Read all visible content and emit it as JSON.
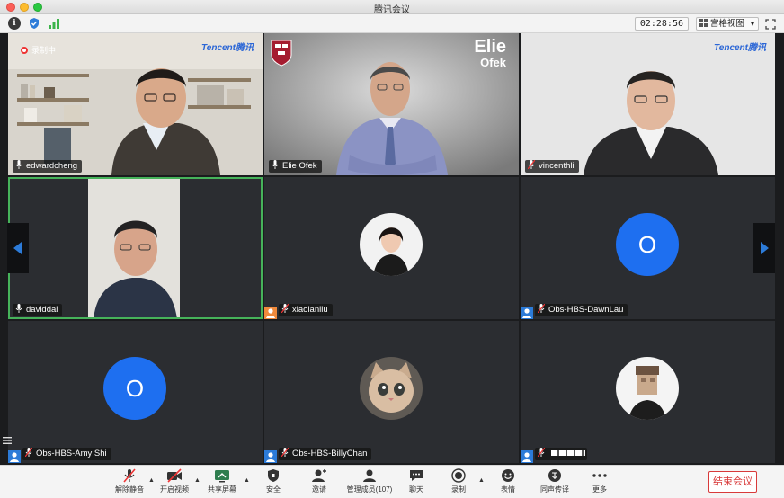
{
  "window": {
    "title": "腾讯会议"
  },
  "topbar": {
    "timer": "02:28:56",
    "view_label": "宫格视图"
  },
  "recording_label": "录制中",
  "brand_logo": "Tencent腾讯",
  "banner_name": {
    "first": "Elie",
    "last": "Ofek"
  },
  "participants": [
    {
      "name": "edwardcheng",
      "type": "video"
    },
    {
      "name": "Elie Ofek",
      "type": "video"
    },
    {
      "name": "vincenthli",
      "type": "video"
    },
    {
      "name": "daviddai",
      "type": "video"
    },
    {
      "name": "xiaolanliu",
      "type": "photo"
    },
    {
      "name": "Obs-HBS-DawnLau",
      "type": "letter",
      "initial": "O"
    },
    {
      "name": "Obs-HBS-Amy Shi",
      "type": "letter",
      "initial": "O"
    },
    {
      "name": "Obs-HBS-BillyChan",
      "type": "photo"
    },
    {
      "name": "",
      "type": "photo"
    }
  ],
  "bottombar": {
    "items": [
      {
        "label": "解除静音",
        "icon": "mic-muted-icon"
      },
      {
        "label": "开启视频",
        "icon": "camera-off-icon"
      },
      {
        "label": "共享屏幕",
        "icon": "screen-share-icon"
      },
      {
        "label": "安全",
        "icon": "shield-icon"
      },
      {
        "label": "邀请",
        "icon": "invite-icon"
      },
      {
        "label": "管理成员(107)",
        "icon": "members-icon"
      },
      {
        "label": "聊天",
        "icon": "chat-icon"
      },
      {
        "label": "录制",
        "icon": "record-icon"
      },
      {
        "label": "表情",
        "icon": "emoji-icon"
      },
      {
        "label": "同声传译",
        "icon": "interpretation-icon"
      },
      {
        "label": "更多",
        "icon": "more-icon"
      }
    ],
    "end_label": "结束会议"
  },
  "colors": {
    "accent_blue": "#1e6ff0",
    "active_border": "#46b35a",
    "end_red": "#d83a3a"
  }
}
